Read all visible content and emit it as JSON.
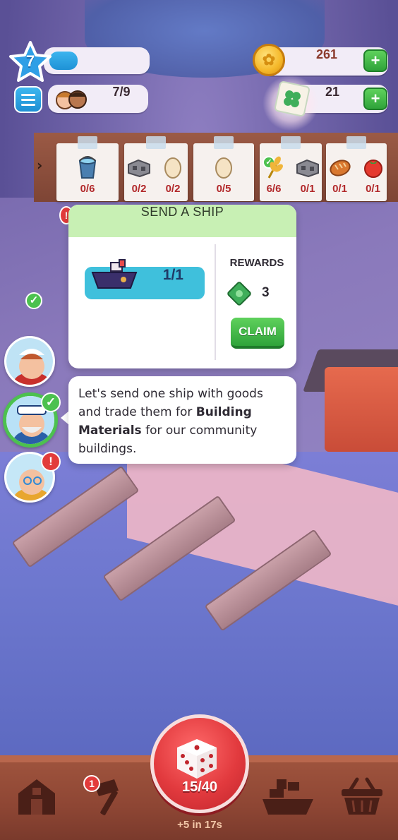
{
  "hud": {
    "level": "7",
    "xp_fraction": 0.3,
    "population": "7/9",
    "coins": "261",
    "clovers": "21",
    "plus_label": "+"
  },
  "orders": [
    {
      "items": [
        {
          "icon": "bucket-icon",
          "count": "0/6"
        }
      ]
    },
    {
      "items": [
        {
          "icon": "cinder-block-icon",
          "count": "0/2"
        },
        {
          "icon": "egg-icon",
          "count": "0/2"
        }
      ]
    },
    {
      "items": [
        {
          "icon": "egg-icon",
          "count": "0/5"
        }
      ]
    },
    {
      "items": [
        {
          "icon": "wheat-icon",
          "count": "6/6",
          "done": true
        },
        {
          "icon": "cinder-block-icon",
          "count": "0/1"
        }
      ]
    },
    {
      "items": [
        {
          "icon": "bread-icon",
          "count": "0/1"
        },
        {
          "icon": "tomato-icon",
          "count": "0/1"
        }
      ]
    }
  ],
  "ship_card": {
    "title": "SEND A SHIP",
    "progress": "1/1",
    "rewards_label": "REWARDS",
    "reward_icon": "cash-icon",
    "reward_count": "3",
    "claim_label": "CLAIM"
  },
  "dialogue": {
    "text_before": "Let's send one ship with goods and trade them for ",
    "text_bold": "Building Materials",
    "text_after": " for our community buildings."
  },
  "avatars": [
    {
      "name": "chef",
      "status": "done"
    },
    {
      "name": "captain",
      "status": "done",
      "active": true
    },
    {
      "name": "grandpa",
      "status": "alert"
    }
  ],
  "bottom": {
    "dice_count": "15/40",
    "dice_timer": "+5 in 17s",
    "build_badge": "1"
  },
  "colors": {
    "accent_green": "#4cc14f",
    "alert_red": "#e23b3b",
    "header_green": "#c8f0b4",
    "dice_red": "#e23a3e"
  }
}
